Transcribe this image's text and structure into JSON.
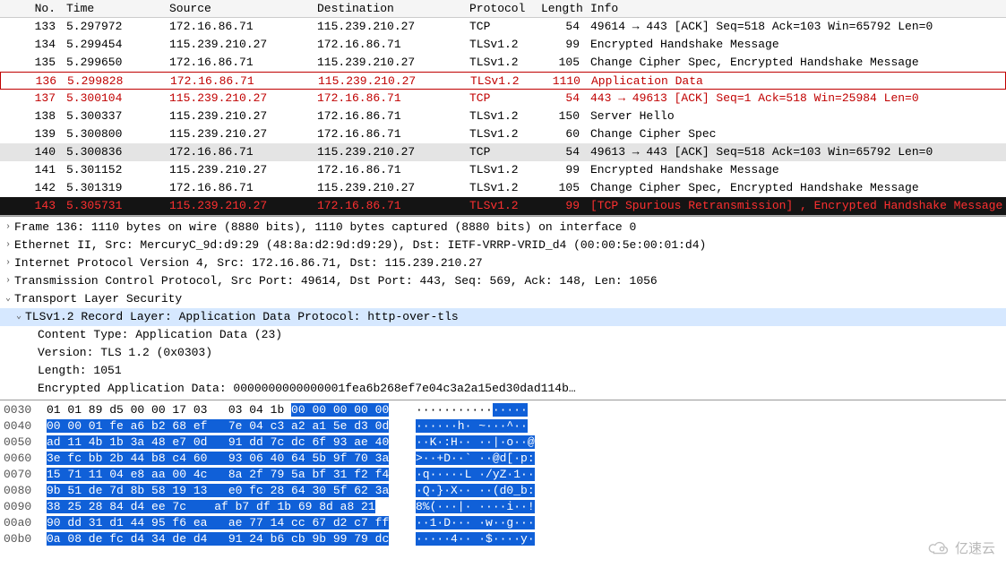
{
  "packet_list": {
    "headers": [
      "No.",
      "Time",
      "Source",
      "Destination",
      "Protocol",
      "Length",
      "Info"
    ],
    "rows": [
      {
        "no": "133",
        "time": "5.297972",
        "src": "172.16.86.71",
        "dst": "115.239.210.27",
        "proto": "TCP",
        "len": "54",
        "info": "49614 → 443 [ACK] Seq=518 Ack=103 Win=65792 Len=0",
        "cls": ""
      },
      {
        "no": "134",
        "time": "5.299454",
        "src": "115.239.210.27",
        "dst": "172.16.86.71",
        "proto": "TLSv1.2",
        "len": "99",
        "info": "Encrypted Handshake Message",
        "cls": ""
      },
      {
        "no": "135",
        "time": "5.299650",
        "src": "172.16.86.71",
        "dst": "115.239.210.27",
        "proto": "TLSv1.2",
        "len": "105",
        "info": "Change Cipher Spec, Encrypted Handshake Message",
        "cls": ""
      },
      {
        "no": "136",
        "time": "5.299828",
        "src": "172.16.86.71",
        "dst": "115.239.210.27",
        "proto": "TLSv1.2",
        "len": "1110",
        "info": "Application Data",
        "cls": "row-red row-boxed"
      },
      {
        "no": "137",
        "time": "5.300104",
        "src": "115.239.210.27",
        "dst": "172.16.86.71",
        "proto": "TCP",
        "len": "54",
        "info": "443 → 49613 [ACK] Seq=1 Ack=518 Win=25984 Len=0",
        "cls": "row-red"
      },
      {
        "no": "138",
        "time": "5.300337",
        "src": "115.239.210.27",
        "dst": "172.16.86.71",
        "proto": "TLSv1.2",
        "len": "150",
        "info": "Server Hello",
        "cls": ""
      },
      {
        "no": "139",
        "time": "5.300800",
        "src": "115.239.210.27",
        "dst": "172.16.86.71",
        "proto": "TLSv1.2",
        "len": "60",
        "info": "Change Cipher Spec",
        "cls": ""
      },
      {
        "no": "140",
        "time": "5.300836",
        "src": "172.16.86.71",
        "dst": "115.239.210.27",
        "proto": "TCP",
        "len": "54",
        "info": "49613 → 443 [ACK] Seq=518 Ack=103 Win=65792 Len=0",
        "cls": "row-grey"
      },
      {
        "no": "141",
        "time": "5.301152",
        "src": "115.239.210.27",
        "dst": "172.16.86.71",
        "proto": "TLSv1.2",
        "len": "99",
        "info": "Encrypted Handshake Message",
        "cls": ""
      },
      {
        "no": "142",
        "time": "5.301319",
        "src": "172.16.86.71",
        "dst": "115.239.210.27",
        "proto": "TLSv1.2",
        "len": "105",
        "info": "Change Cipher Spec, Encrypted Handshake Message",
        "cls": ""
      },
      {
        "no": "143",
        "time": "5.305731",
        "src": "115.239.210.27",
        "dst": "172.16.86.71",
        "proto": "TLSv1.2",
        "len": "99",
        "info": "[TCP Spurious Retransmission] , Encrypted Handshake Message",
        "cls": "row-warn"
      }
    ]
  },
  "details": {
    "frame": "Frame 136: 1110 bytes on wire (8880 bits), 1110 bytes captured (8880 bits) on interface 0",
    "eth": "Ethernet II, Src: MercuryC_9d:d9:29 (48:8a:d2:9d:d9:29), Dst: IETF-VRRP-VRID_d4 (00:00:5e:00:01:d4)",
    "ip": "Internet Protocol Version 4, Src: 172.16.86.71, Dst: 115.239.210.27",
    "tcp": "Transmission Control Protocol, Src Port: 49614, Dst Port: 443, Seq: 569, Ack: 148, Len: 1056",
    "tls": "Transport Layer Security",
    "record": "TLSv1.2 Record Layer: Application Data Protocol: http-over-tls",
    "ctype": "Content Type: Application Data (23)",
    "ver": "Version: TLS 1.2 (0x0303)",
    "len": "Length: 1051",
    "encdata": "Encrypted Application Data: 0000000000000001fea6b268ef7e04c3a2a15ed30dad114b…"
  },
  "hex": {
    "rows": [
      {
        "off": "0030",
        "plain": "01 01 89 d5 00 00 17 03   03 04 1b ",
        "hl": "00 00 00 00 00",
        "ascP": "···········",
        "ascH": "·····"
      },
      {
        "off": "0040",
        "plain": "",
        "hl": "00 00 01 fe a6 b2 68 ef   7e 04 c3 a2 a1 5e d3 0d",
        "ascP": "",
        "ascH": "······h· ~···^··"
      },
      {
        "off": "0050",
        "plain": "",
        "hl": "ad 11 4b 1b 3a 48 e7 0d   91 dd 7c dc 6f 93 ae 40",
        "ascP": "",
        "ascH": "··K·:H·· ··|·o··@"
      },
      {
        "off": "0060",
        "plain": "",
        "hl": "3e fc bb 2b 44 b8 c4 60   93 06 40 64 5b 9f 70 3a",
        "ascP": "",
        "ascH": ">··+D··` ··@d[·p:"
      },
      {
        "off": "0070",
        "plain": "",
        "hl": "15 71 11 04 e8 aa 00 4c   8a 2f 79 5a bf 31 f2 f4",
        "ascP": "",
        "ascH": "·q·····L ·/yZ·1··"
      },
      {
        "off": "0080",
        "plain": "",
        "hl": "9b 51 de 7d 8b 58 19 13   e0 fc 28 64 30 5f 62 3a",
        "ascP": "",
        "ascH": "·Q·}·X·· ··(d0_b:"
      },
      {
        "off": "0090",
        "plain": "",
        "hl": "38 25 28 84 d4 ee 7c    af b7 df 1b 69 8d a8 21",
        "ascP": "",
        "ascH": "8%(···|· ····i··!"
      },
      {
        "off": "00a0",
        "plain": "",
        "hl": "90 dd 31 d1 44 95 f6 ea   ae 77 14 cc 67 d2 c7 ff",
        "ascP": "",
        "ascH": "··1·D··· ·w··g···"
      },
      {
        "off": "00b0",
        "plain": "",
        "hl": "0a 08 de fc d4 34 de d4   91 24 b6 cb 9b 99 79 dc",
        "ascP": "",
        "ascH": "·····4·· ·$····y·"
      }
    ]
  },
  "watermark": "亿速云",
  "chart_data": {
    "type": "table",
    "title": "Wireshark packet capture — TLS Application Data frame 136",
    "columns": [
      "No.",
      "Time",
      "Source",
      "Destination",
      "Protocol",
      "Length",
      "Info"
    ],
    "rows": [
      [
        133,
        "5.297972",
        "172.16.86.71",
        "115.239.210.27",
        "TCP",
        54,
        "49614 → 443 [ACK] Seq=518 Ack=103 Win=65792 Len=0"
      ],
      [
        134,
        "5.299454",
        "115.239.210.27",
        "172.16.86.71",
        "TLSv1.2",
        99,
        "Encrypted Handshake Message"
      ],
      [
        135,
        "5.299650",
        "172.16.86.71",
        "115.239.210.27",
        "TLSv1.2",
        105,
        "Change Cipher Spec, Encrypted Handshake Message"
      ],
      [
        136,
        "5.299828",
        "172.16.86.71",
        "115.239.210.27",
        "TLSv1.2",
        1110,
        "Application Data"
      ],
      [
        137,
        "5.300104",
        "115.239.210.27",
        "172.16.86.71",
        "TCP",
        54,
        "443 → 49613 [ACK] Seq=1 Ack=518 Win=25984 Len=0"
      ],
      [
        138,
        "5.300337",
        "115.239.210.27",
        "172.16.86.71",
        "TLSv1.2",
        150,
        "Server Hello"
      ],
      [
        139,
        "5.300800",
        "115.239.210.27",
        "172.16.86.71",
        "TLSv1.2",
        60,
        "Change Cipher Spec"
      ],
      [
        140,
        "5.300836",
        "172.16.86.71",
        "115.239.210.27",
        "TCP",
        54,
        "49613 → 443 [ACK] Seq=518 Ack=103 Win=65792 Len=0"
      ],
      [
        141,
        "5.301152",
        "115.239.210.27",
        "172.16.86.71",
        "TLSv1.2",
        99,
        "Encrypted Handshake Message"
      ],
      [
        142,
        "5.301319",
        "172.16.86.71",
        "115.239.210.27",
        "TLSv1.2",
        105,
        "Change Cipher Spec, Encrypted Handshake Message"
      ],
      [
        143,
        "5.305731",
        "115.239.210.27",
        "172.16.86.71",
        "TLSv1.2",
        99,
        "[TCP Spurious Retransmission] , Encrypted Handshake Message"
      ]
    ]
  }
}
